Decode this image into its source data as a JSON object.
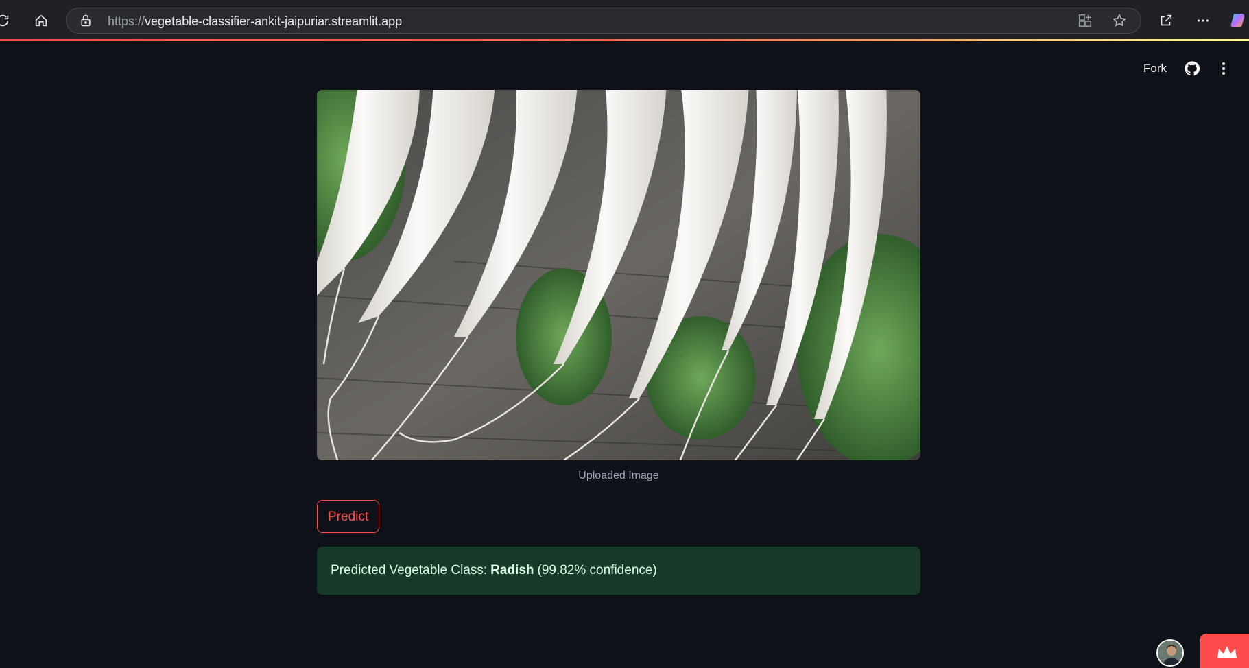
{
  "browser": {
    "url_scheme": "https://",
    "url_host": "vegetable-classifier-ankit-jaipuriar.streamlit.app",
    "icons": [
      "refresh-icon",
      "home-icon",
      "lock-icon",
      "app-available-icon",
      "favorite-star-icon",
      "share-icon",
      "more-menu-icon",
      "copilot-icon"
    ]
  },
  "header": {
    "fork_label": "Fork",
    "icons": [
      "github-icon",
      "kebab-menu-icon"
    ]
  },
  "main": {
    "image_caption": "Uploaded Image",
    "predict_label": "Predict",
    "result": {
      "prefix": "Predicted Vegetable Class:",
      "class_name": "Radish",
      "suffix": "(99.82% confidence)"
    }
  },
  "colors": {
    "background": "#0e1117",
    "accent": "#ff4b4b",
    "success_bg": "#173928",
    "success_text": "#dffde9"
  }
}
